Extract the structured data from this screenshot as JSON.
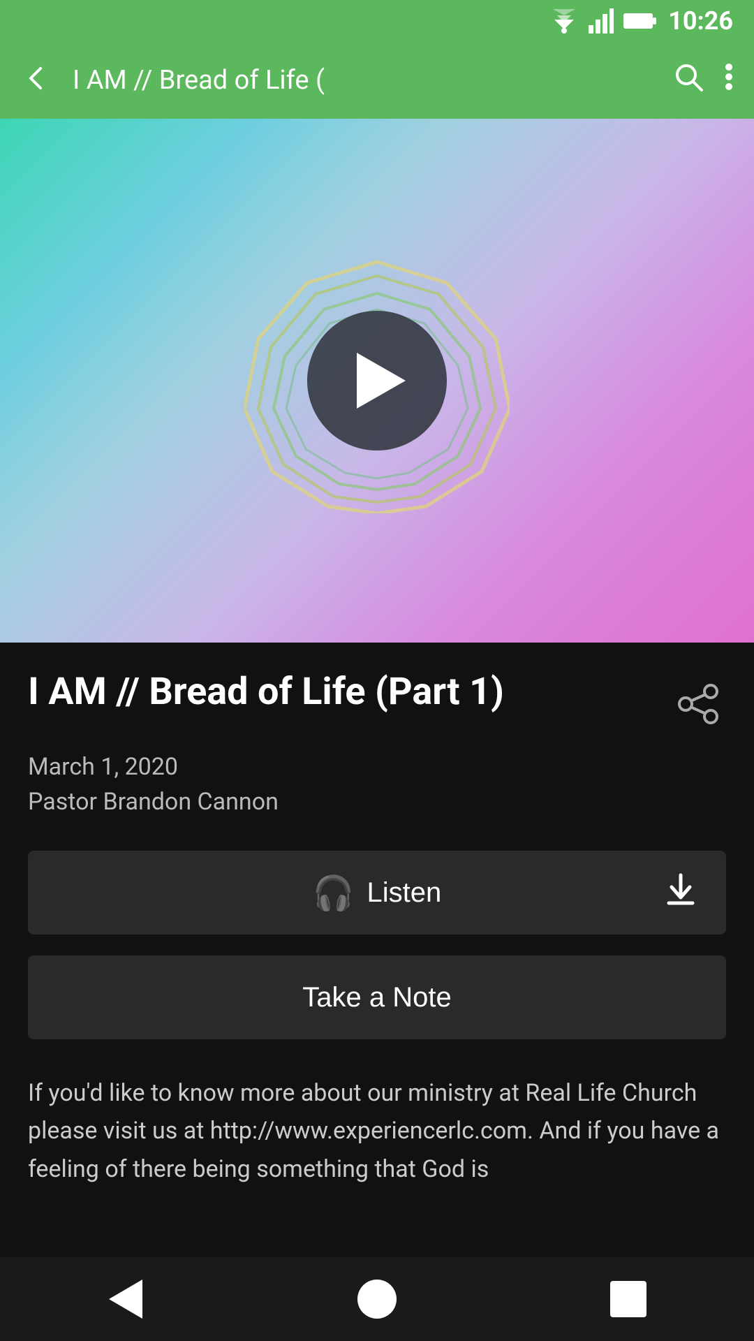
{
  "status": {
    "time": "10:26"
  },
  "appBar": {
    "title": "I AM // Bread of Life (",
    "back_label": "←",
    "search_label": "🔍",
    "more_label": "⋮"
  },
  "hero": {
    "play_label": "Play"
  },
  "content": {
    "title": "I AM // Bread of Life (Part 1)",
    "date": "March 1, 2020",
    "author": "Pastor Brandon Cannon",
    "listen_label": "Listen",
    "note_label": "Take a Note",
    "description": "If you'd like to know more about our ministry at Real Life Church please visit us at http://www.experiencerlc.com. And if you have a feeling of there being something that God is"
  },
  "nav": {
    "back_label": "Back",
    "home_label": "Home",
    "recent_label": "Recent"
  }
}
